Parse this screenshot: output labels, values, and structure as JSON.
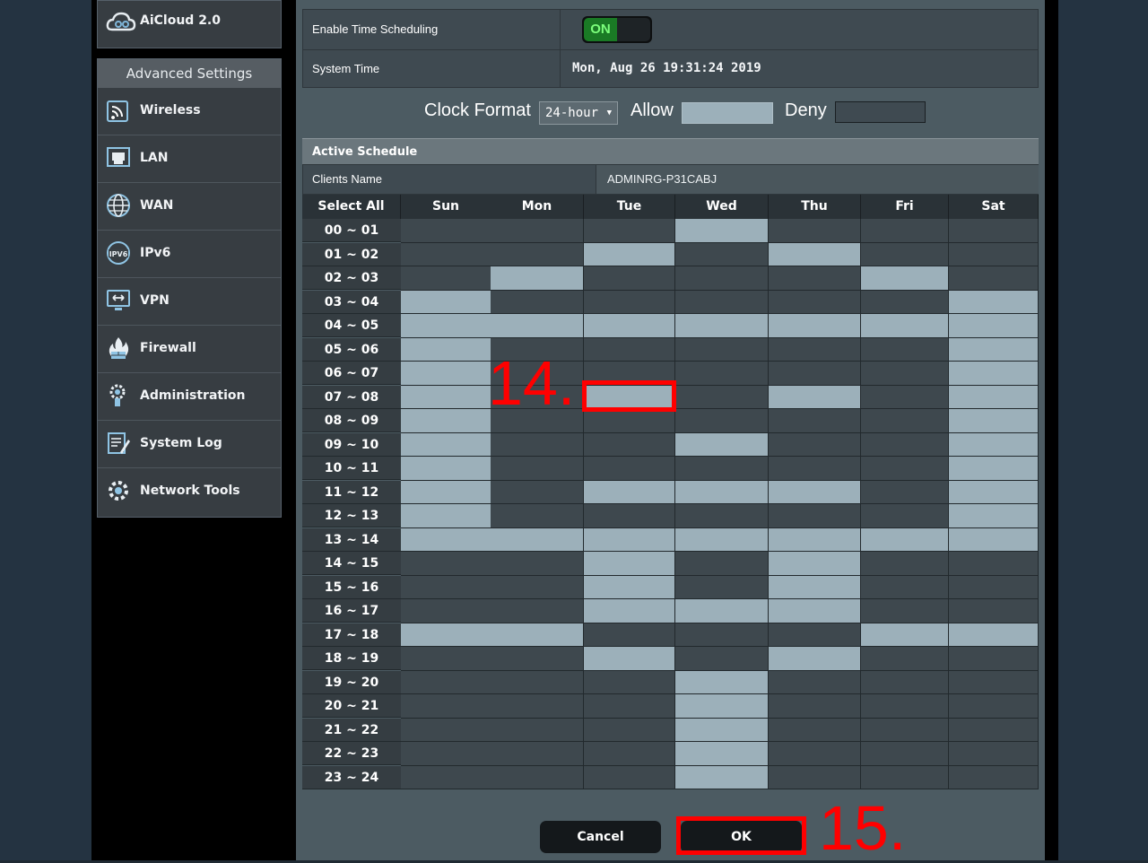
{
  "sidebar": {
    "aicloud": {
      "label": "AiCloud 2.0",
      "icon": "cloud-icon"
    },
    "advanced_title": "Advanced Settings",
    "items": [
      {
        "label": "Wireless",
        "icon": "wireless-icon"
      },
      {
        "label": "LAN",
        "icon": "lan-icon"
      },
      {
        "label": "WAN",
        "icon": "wan-globe-icon"
      },
      {
        "label": "IPv6",
        "icon": "ipv6-icon"
      },
      {
        "label": "VPN",
        "icon": "vpn-icon"
      },
      {
        "label": "Firewall",
        "icon": "firewall-icon"
      },
      {
        "label": "Administration",
        "icon": "administration-icon"
      },
      {
        "label": "System Log",
        "icon": "system-log-icon"
      },
      {
        "label": "Network Tools",
        "icon": "network-tools-icon"
      }
    ]
  },
  "settings": {
    "enable_label": "Enable Time Scheduling",
    "enable_state": "ON",
    "system_time_label": "System Time",
    "system_time_value": "Mon, Aug 26 19:31:24 2019"
  },
  "clock": {
    "label": "Clock Format",
    "selected": "24-hour",
    "allow_label": "Allow",
    "deny_label": "Deny",
    "allow_color": "#9cb0ba",
    "deny_color": "#3f4a51"
  },
  "schedule": {
    "title": "Active Schedule",
    "clients_label": "Clients Name",
    "clients_value": "ADMINRG-P31CABJ",
    "select_all": "Select All",
    "days": [
      "Sun",
      "Mon",
      "Tue",
      "Wed",
      "Thu",
      "Fri",
      "Sat"
    ],
    "hours": [
      "00 ~ 01",
      "01 ~ 02",
      "02 ~ 03",
      "03 ~ 04",
      "04 ~ 05",
      "05 ~ 06",
      "06 ~ 07",
      "07 ~ 08",
      "08 ~ 09",
      "09 ~ 10",
      "10 ~ 11",
      "11 ~ 12",
      "12 ~ 13",
      "13 ~ 14",
      "14 ~ 15",
      "15 ~ 16",
      "16 ~ 17",
      "17 ~ 18",
      "18 ~ 19",
      "19 ~ 20",
      "20 ~ 21",
      "21 ~ 22",
      "22 ~ 23",
      "23 ~ 24"
    ],
    "allowed": [
      [
        0,
        0,
        0,
        1,
        0,
        0,
        0
      ],
      [
        0,
        0,
        1,
        0,
        1,
        0,
        0
      ],
      [
        0,
        1,
        0,
        0,
        0,
        1,
        0
      ],
      [
        1,
        0,
        0,
        0,
        0,
        0,
        1
      ],
      [
        1,
        1,
        1,
        1,
        1,
        1,
        1
      ],
      [
        1,
        0,
        0,
        0,
        0,
        0,
        1
      ],
      [
        1,
        0,
        0,
        0,
        0,
        0,
        1
      ],
      [
        1,
        0,
        1,
        0,
        1,
        0,
        1
      ],
      [
        1,
        0,
        0,
        0,
        0,
        0,
        1
      ],
      [
        1,
        0,
        0,
        1,
        0,
        0,
        1
      ],
      [
        1,
        0,
        0,
        0,
        0,
        0,
        1
      ],
      [
        1,
        0,
        1,
        1,
        1,
        0,
        1
      ],
      [
        1,
        0,
        0,
        0,
        0,
        0,
        1
      ],
      [
        1,
        1,
        1,
        1,
        1,
        1,
        1
      ],
      [
        0,
        0,
        1,
        0,
        1,
        0,
        0
      ],
      [
        0,
        0,
        1,
        0,
        1,
        0,
        0
      ],
      [
        0,
        0,
        1,
        1,
        1,
        0,
        0
      ],
      [
        1,
        1,
        0,
        0,
        0,
        1,
        1
      ],
      [
        0,
        0,
        1,
        0,
        1,
        0,
        0
      ],
      [
        0,
        0,
        0,
        1,
        0,
        0,
        0
      ],
      [
        0,
        0,
        0,
        1,
        0,
        0,
        0
      ],
      [
        0,
        0,
        0,
        1,
        0,
        0,
        0
      ],
      [
        0,
        0,
        0,
        1,
        0,
        0,
        0
      ],
      [
        0,
        0,
        0,
        1,
        0,
        0,
        0
      ]
    ]
  },
  "buttons": {
    "cancel": "Cancel",
    "ok": "OK"
  },
  "annotations": {
    "step14": "14.",
    "step15": "15.",
    "color": "#ff0000"
  }
}
